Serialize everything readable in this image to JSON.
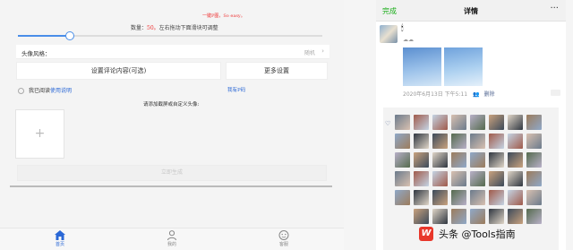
{
  "left": {
    "top_notice": "一键P图，So easy。",
    "count_label": "数量：",
    "count_value": "50。",
    "count_hint": "左右拖动下面滑块可调整",
    "slider_fraction": 0.17,
    "avatar_style_label": "头像风格：",
    "avatar_style_value": "随机",
    "set_comment_button": "设置评论内容(可选)",
    "more_settings_button": "更多设置",
    "agree_text": "我已阅读",
    "agree_link": "使用说明",
    "code_link": "我有P码",
    "upload_hint": "请添加截屏或自定义头像:",
    "upload_plus": "+",
    "generate_button": "立即生成",
    "tabs": [
      {
        "label": "首页",
        "icon": "home-icon",
        "active": true
      },
      {
        "label": "我的",
        "icon": "user-icon",
        "active": false
      },
      {
        "label": "客服",
        "icon": "service-icon",
        "active": false
      }
    ]
  },
  "right": {
    "done_label": "完成",
    "title": "详情",
    "more_icon": "···",
    "small_emoji": "🕯",
    "weather_emoji": "☁☁",
    "timestamp": "2020年6月13日 下午5:11",
    "privacy_icon": "👥",
    "delete_label": "删除",
    "comment_icon": "··",
    "like_heart": "♡",
    "watermark_logo": "W",
    "watermark_text": "头条 @Tools指南",
    "colors": {
      "wechat_green": "#1aad19",
      "link_blue": "#576b95"
    }
  }
}
